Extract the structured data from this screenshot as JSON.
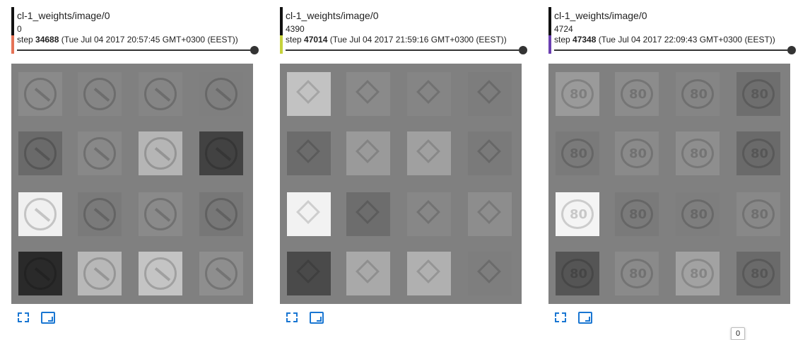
{
  "cards": [
    {
      "title": "cl-1_weights/image/0",
      "sample": "0",
      "step_label": "step",
      "step_value": "34688",
      "step_time": "(Tue Jul 04 2017 20:57:45 GMT+0300 (EEST))",
      "run_color": "#e57357",
      "glyph": "arrow-sign",
      "cell_tones": [
        [
          "#8a8a8a",
          "#858585",
          "#858585",
          "#7f7f7f"
        ],
        [
          "#6a6a6a",
          "#888888",
          "#b5b5b5",
          "#424242"
        ],
        [
          "#f0f0f0",
          "#7a7a7a",
          "#8a8a8a",
          "#777777"
        ],
        [
          "#2a2a2a",
          "#b8b8b8",
          "#c4c4c4",
          "#8e8e8e"
        ]
      ]
    },
    {
      "title": "cl-1_weights/image/0",
      "sample": "4390",
      "step_label": "step",
      "step_value": "47014",
      "step_time": "(Tue Jul 04 2017 21:59:16 GMT+0300 (EEST))",
      "run_color": "#c6d23b",
      "glyph": "diamond-sign",
      "cell_tones": [
        [
          "#c2c2c2",
          "#8a8a8a",
          "#858585",
          "#7d7d7d"
        ],
        [
          "#6c6c6c",
          "#9a9a9a",
          "#a0a0a0",
          "#7a7a7a"
        ],
        [
          "#f2f2f2",
          "#6d6d6d",
          "#878787",
          "#8d8d8d"
        ],
        [
          "#4a4a4a",
          "#a9a9a9",
          "#b0b0b0",
          "#7e7e7e"
        ]
      ]
    },
    {
      "title": "cl-1_weights/image/0",
      "sample": "4724",
      "step_label": "step",
      "step_value": "47348",
      "step_time": "(Tue Jul 04 2017 22:09:43 GMT+0300 (EEST))",
      "run_color": "#6a3fb0",
      "glyph": "speed-80-sign",
      "tooltip": "0",
      "cell_tones": [
        [
          "#9a9a9a",
          "#8c8c8c",
          "#858585",
          "#6e6e6e"
        ],
        [
          "#7a7a7a",
          "#8a8a8a",
          "#8e8e8e",
          "#6a6a6a"
        ],
        [
          "#f4f4f4",
          "#7a7a7a",
          "#7e7e7e",
          "#888888"
        ],
        [
          "#555555",
          "#8a8a8a",
          "#a2a2a2",
          "#6a6a6a"
        ]
      ]
    }
  ],
  "icons": {
    "expand": "fullscreen-expand-icon",
    "fit": "fit-to-size-icon"
  }
}
